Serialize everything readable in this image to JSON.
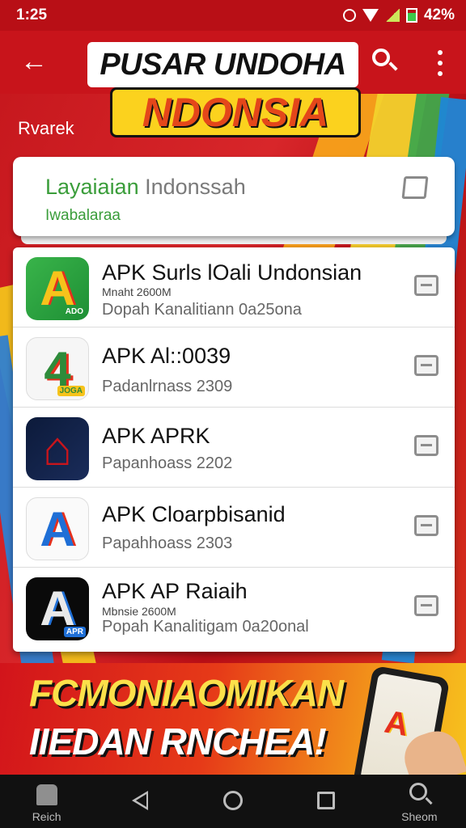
{
  "status_bar": {
    "time": "1:25",
    "battery": "42%"
  },
  "app_bar": {
    "title": "PUSAR UNDOHA",
    "subtitle": "NDONSIA"
  },
  "section_label": "Rvarek",
  "search_card": {
    "title_green": "Layaiaian",
    "title_gray": "Indonssah",
    "subtitle": "Iwabalaraa"
  },
  "apps": [
    {
      "name": "APK Surls lOali Undonsian",
      "meta": "Mnaht 2600M",
      "desc": "Dopah Kanalitiann 0a25ona",
      "icon": "app-icon-a-green",
      "tag": "ADO"
    },
    {
      "name": "APK Al::0039",
      "meta": "",
      "desc": "Padanlrnass 2309",
      "icon": "app-icon-4-green",
      "tag": "JOGA"
    },
    {
      "name": "APK APRK",
      "meta": "",
      "desc": "Papanhoass 2202",
      "icon": "app-icon-house-red",
      "tag": ""
    },
    {
      "name": "APK Cloarpbisanid",
      "meta": "",
      "desc": "Papahhoass 2303",
      "icon": "app-icon-a-blue",
      "tag": ""
    },
    {
      "name": "APK AP Raiaih",
      "meta": "Mbnsie 2600M",
      "desc": "Popah Kanalitigam 0a20onal",
      "icon": "app-icon-a-black",
      "tag": "APR"
    }
  ],
  "promo": {
    "line1": "FCMONIAOMIKAN",
    "line2": "IIEDAN RNCHEA!"
  },
  "nav": {
    "home_label": "Reich",
    "search_label": "Sheom"
  }
}
